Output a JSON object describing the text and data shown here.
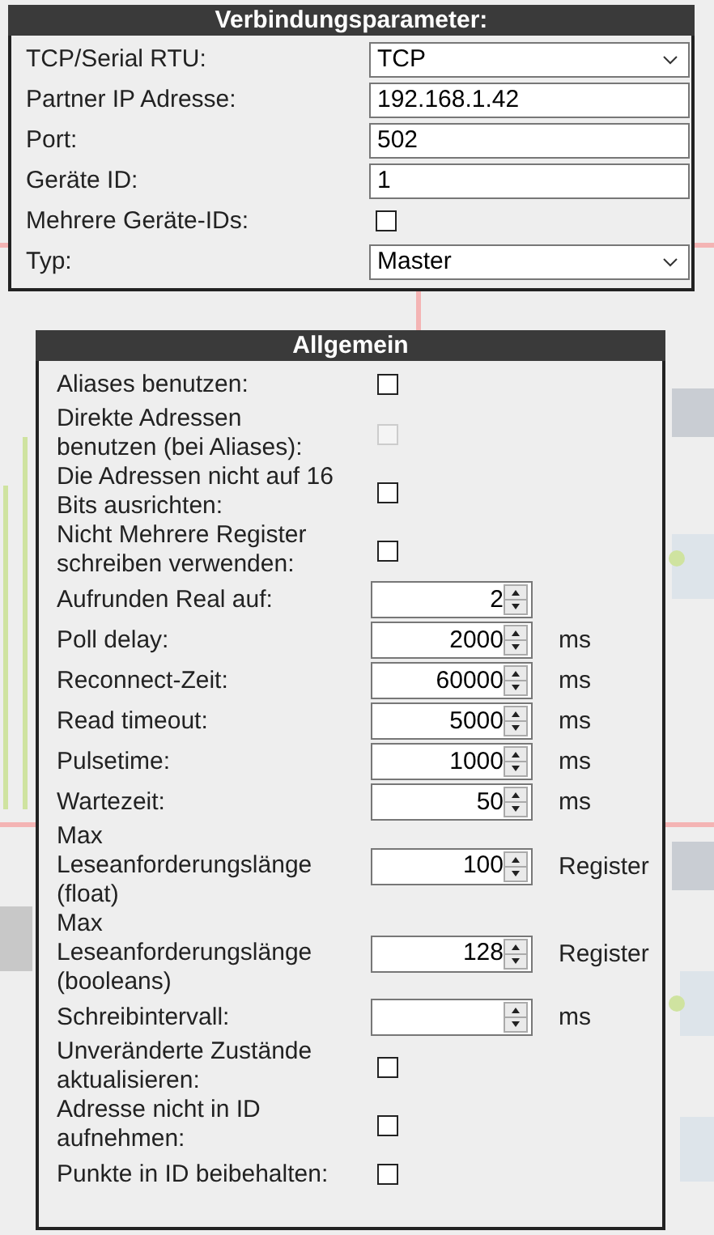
{
  "connection": {
    "title": "Verbindungsparameter:",
    "rows": [
      {
        "kind": "select",
        "label": "TCP/Serial RTU:",
        "value": "TCP"
      },
      {
        "kind": "text",
        "label": "Partner IP Adresse:",
        "value": "192.168.1.42"
      },
      {
        "kind": "text",
        "label": "Port:",
        "value": "502"
      },
      {
        "kind": "text",
        "label": "Geräte ID:",
        "value": "1"
      },
      {
        "kind": "checkbox",
        "label": "Mehrere Geräte-IDs:",
        "checked": false,
        "disabled": false
      },
      {
        "kind": "select",
        "label": "Typ:",
        "value": "Master"
      }
    ]
  },
  "general": {
    "title": "Allgemein",
    "rows": [
      {
        "kind": "checkbox",
        "label": "Aliases benutzen:",
        "checked": false,
        "disabled": false
      },
      {
        "kind": "checkbox",
        "label": "Direkte Adressen benutzen (bei Aliases):",
        "checked": false,
        "disabled": true
      },
      {
        "kind": "checkbox",
        "label": "Die Adressen nicht auf 16 Bits ausrichten:",
        "checked": false,
        "disabled": false
      },
      {
        "kind": "checkbox",
        "label": "Nicht Mehrere Register schreiben verwenden:",
        "checked": false,
        "disabled": false
      },
      {
        "kind": "number",
        "label": "Aufrunden Real auf:",
        "value": "2"
      },
      {
        "kind": "number",
        "label": "Poll delay:",
        "value": "2000",
        "unit": "ms"
      },
      {
        "kind": "number",
        "label": "Reconnect-Zeit:",
        "value": "60000",
        "unit": "ms"
      },
      {
        "kind": "number",
        "label": "Read timeout:",
        "value": "5000",
        "unit": "ms"
      },
      {
        "kind": "number",
        "label": "Pulsetime:",
        "value": "1000",
        "unit": "ms"
      },
      {
        "kind": "number",
        "label": "Wartezeit:",
        "value": "50",
        "unit": "ms"
      },
      {
        "kind": "number",
        "label": "Max Leseanforderungslänge (float)",
        "value": "100",
        "unit": "Register"
      },
      {
        "kind": "number",
        "label": "Max Leseanforderungslänge (booleans)",
        "value": "128",
        "unit": "Register"
      },
      {
        "kind": "number",
        "label": "Schreibintervall:",
        "unit": "ms"
      },
      {
        "kind": "checkbox",
        "label": "Unveränderte Zustände aktualisieren:",
        "checked": false,
        "disabled": false
      },
      {
        "kind": "checkbox",
        "label": "Adresse nicht in ID aufnehmen:",
        "checked": false,
        "disabled": false
      },
      {
        "kind": "checkbox",
        "label": "Punkte in ID beibehalten:",
        "checked": false,
        "disabled": false
      }
    ]
  }
}
